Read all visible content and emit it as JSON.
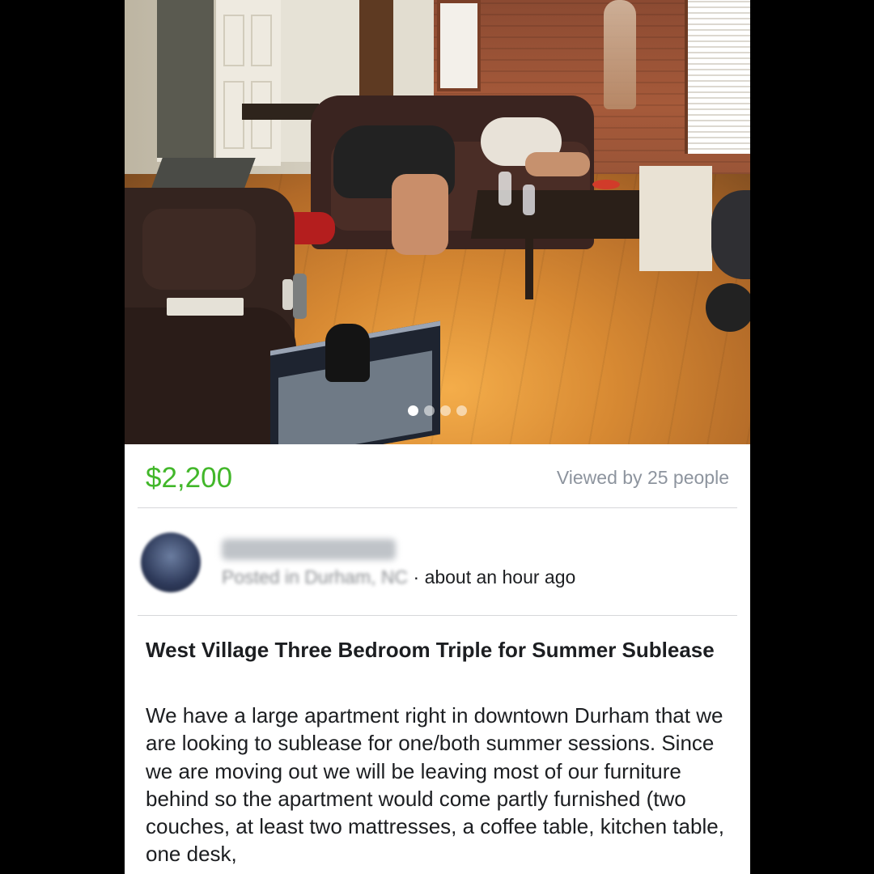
{
  "listing": {
    "price": "$2,200",
    "viewed": "Viewed by 25 people",
    "seller": {
      "posted_prefix": "Posted in",
      "location": "Durham, NC",
      "separator": "·",
      "time": "about an hour ago"
    },
    "title": "West Village Three Bedroom Triple for Summer Sublease",
    "description": "We have a large apartment right in downtown Durham that we are looking to sublease for one/both summer sessions. Since we are moving out we will be leaving most of our furniture behind so the apartment would come partly furnished (two couches, at least two mattresses, a coffee table, kitchen table, one desk,"
  },
  "photo_carousel": {
    "total": 4,
    "active_index": 0
  },
  "colors": {
    "price": "#42b72a",
    "muted_text": "#8d949e",
    "text": "#1c1e21",
    "divider": "#d6d7da"
  }
}
